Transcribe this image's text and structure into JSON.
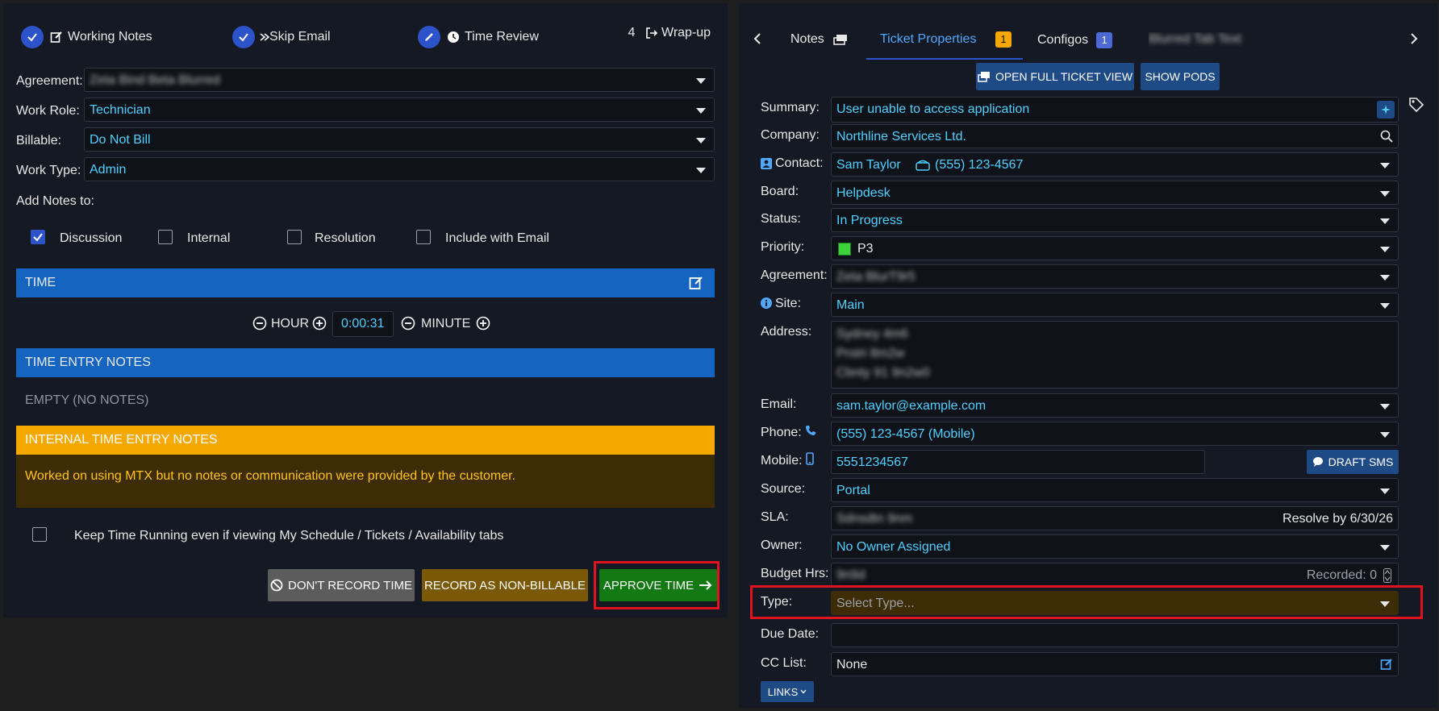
{
  "left": {
    "steps": [
      {
        "label": "Working Notes",
        "state": "done",
        "icon": "edit-icon"
      },
      {
        "label": "Skip Email",
        "state": "done",
        "icon": "skip-icon"
      },
      {
        "label": "Time Review",
        "state": "current",
        "icon": "clock-icon"
      },
      {
        "number": "4",
        "label": "Wrap-up",
        "state": "pending",
        "icon": "exit-icon"
      }
    ],
    "agreement": {
      "label": "Agreement:",
      "value": "Zeta Bind Beta Blurred"
    },
    "work_role": {
      "label": "Work Role:",
      "value": "Technician"
    },
    "billable": {
      "label": "Billable:",
      "value": "Do Not Bill"
    },
    "work_type": {
      "label": "Work Type:",
      "value": "Admin"
    },
    "add_notes_label": "Add Notes to:",
    "notes_targets": [
      {
        "label": "Discussion",
        "checked": true
      },
      {
        "label": "Internal",
        "checked": false
      },
      {
        "label": "Resolution",
        "checked": false
      },
      {
        "label": "Include with Email",
        "checked": false
      }
    ],
    "time_header": "TIME",
    "hour_label": "HOUR",
    "minute_label": "MINUTE",
    "time_value": "0:00:31",
    "time_entry_header": "TIME ENTRY NOTES",
    "time_entry_empty": "EMPTY (NO NOTES)",
    "internal_header": "INTERNAL TIME ENTRY NOTES",
    "internal_text": "Worked on using MTX but no notes or communication were provided by the customer.",
    "keep_running_label": "Keep Time Running even if viewing My Schedule / Tickets / Availability tabs",
    "dont_record_label": "DON'T RECORD TIME",
    "non_billable_label": "RECORD AS NON-BILLABLE",
    "approve_label": "APPROVE TIME"
  },
  "right": {
    "tabs": [
      {
        "label": "Notes"
      },
      {
        "label": "Ticket Properties",
        "badge": "1",
        "active": true
      },
      {
        "label": "Configos",
        "badge": "1"
      },
      {
        "label": "Blurred Tab Text"
      }
    ],
    "open_full_label": "OPEN FULL TICKET VIEW",
    "show_pods_label": "SHOW PODS",
    "summary": {
      "label": "Summary:",
      "value": "User unable to access application"
    },
    "company": {
      "label": "Company:",
      "value": "Northline Services Ltd."
    },
    "contact": {
      "label": "Contact:",
      "value": "Sam Taylor",
      "phone": "(555) 123-4567"
    },
    "board": {
      "label": "Board:",
      "value": "Helpdesk"
    },
    "status": {
      "label": "Status:",
      "value": "In Progress"
    },
    "priority": {
      "label": "Priority:",
      "value": "P3",
      "color": "#3bd13b"
    },
    "agreement": {
      "label": "Agreement:",
      "value": "Zeta BlurT9r5"
    },
    "site": {
      "label": "Site:",
      "value": "Main"
    },
    "address": {
      "label": "Address:",
      "lines": [
        "Sydney 4m6",
        "Prstri 8m2w",
        "Cbnty 91 9n2w0"
      ]
    },
    "email": {
      "label": "Email:",
      "value": "sam.taylor@example.com"
    },
    "phone": {
      "label": "Phone:",
      "value": "(555) 123-4567 (Mobile)"
    },
    "mobile": {
      "label": "Mobile:",
      "value": "5551234567"
    },
    "draft_sms_label": "DRAFT SMS",
    "source": {
      "label": "Source:",
      "value": "Portal"
    },
    "sla": {
      "label": "SLA:",
      "value": "Sdnsdtn 9nm",
      "resolve": "Resolve by 6/30/26"
    },
    "owner": {
      "label": "Owner:",
      "value": "No Owner Assigned"
    },
    "budget": {
      "label": "Budget Hrs:",
      "value": "9n9d",
      "recorded": "Recorded: 0"
    },
    "type": {
      "label": "Type:",
      "placeholder": "Select Type..."
    },
    "due_date": {
      "label": "Due Date:",
      "value": ""
    },
    "cc_list": {
      "label": "CC List:",
      "value": "None"
    },
    "links_label": "LINKS"
  },
  "colors": {
    "accent": "#2c53c9",
    "blue_bar": "#1565c0",
    "amber": "#f5a800",
    "highlight_red": "#e0141e",
    "approve_green": "#1a8f1a"
  }
}
